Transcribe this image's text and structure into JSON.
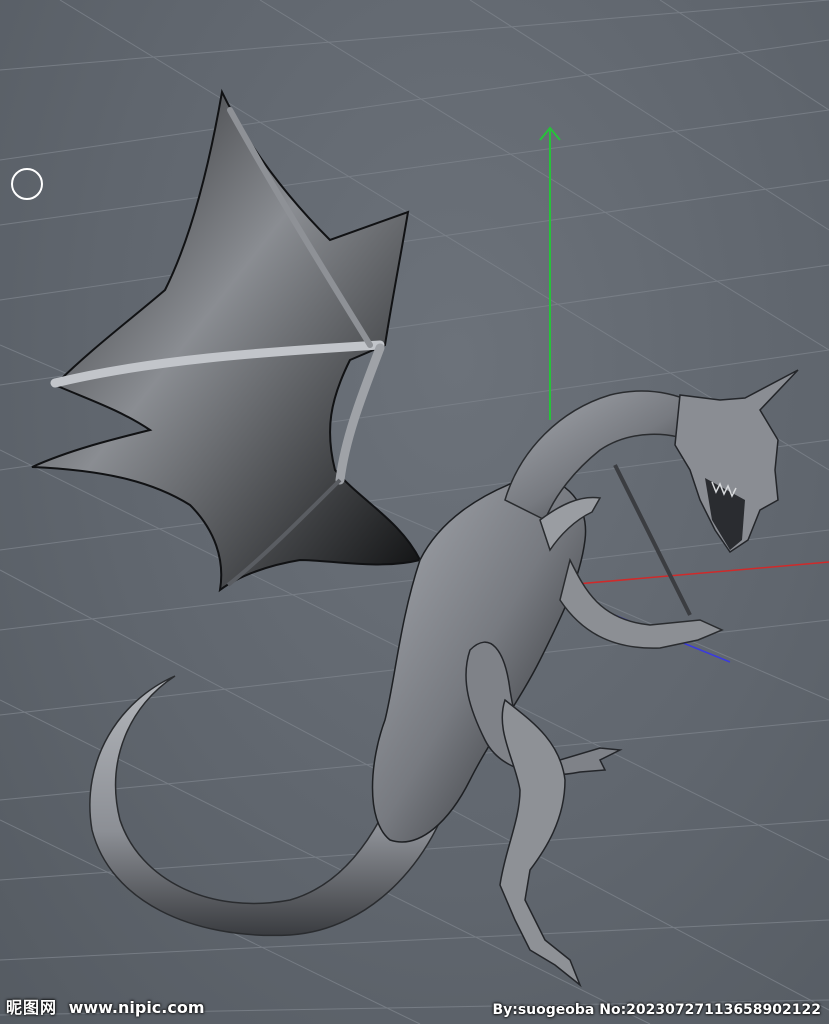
{
  "viewport": {
    "background_color": "#60666e",
    "grid_color": "#7b8189",
    "axis_colors": {
      "y": "#27c23a",
      "x": "#d02a2a",
      "z": "#3a3adf"
    },
    "model_color": "#8d9096",
    "cursor_icon": "circle-cursor-icon"
  },
  "watermark": {
    "logo": "昵图网",
    "site": "www.nipic.com",
    "credit": "By:suogeoba No:20230727113658902122"
  }
}
